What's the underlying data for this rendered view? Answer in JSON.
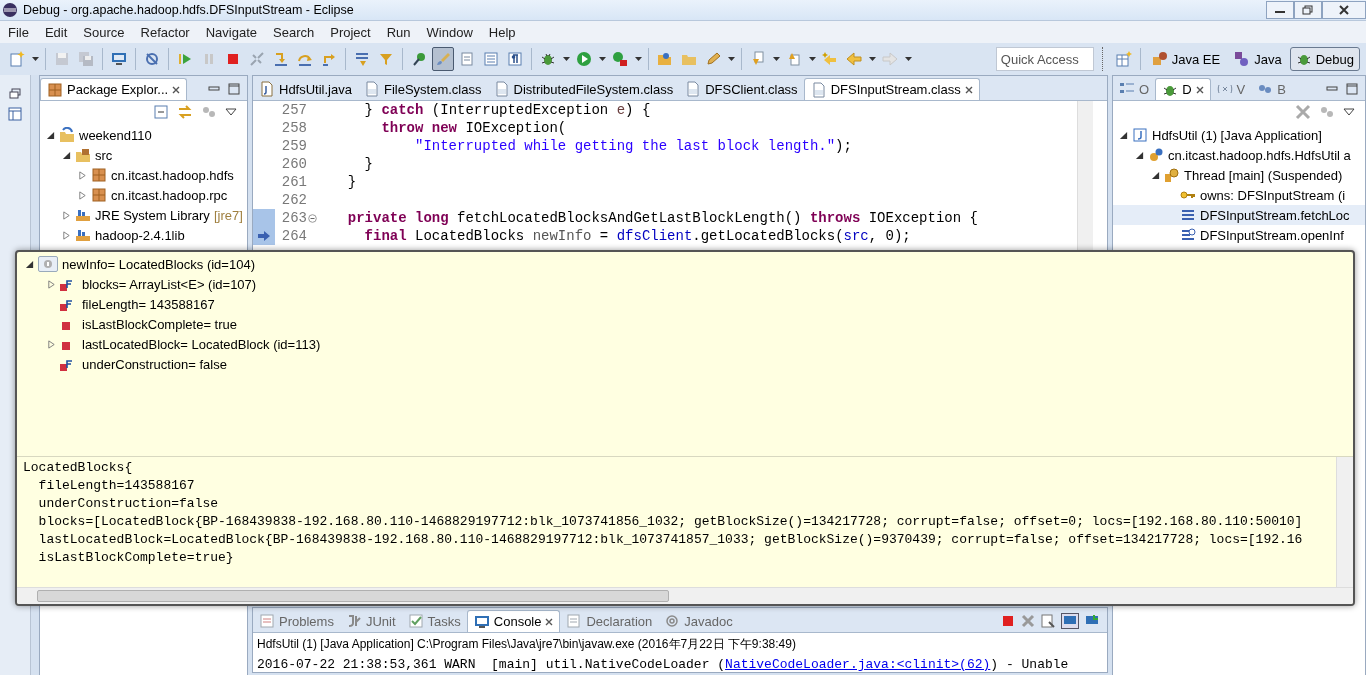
{
  "window": {
    "title": "Debug - org.apache.hadoop.hdfs.DFSInputStream - Eclipse"
  },
  "menu": [
    "File",
    "Edit",
    "Source",
    "Refactor",
    "Navigate",
    "Search",
    "Project",
    "Run",
    "Window",
    "Help"
  ],
  "toolbar": [
    [
      {
        "kind": "new",
        "selected": false
      },
      {
        "kind": "dropdown",
        "selected": false
      }
    ],
    [
      {
        "kind": "save",
        "selected": false
      },
      {
        "kind": "save-all",
        "selected": false
      }
    ],
    [
      {
        "kind": "monitor",
        "selected": false
      }
    ],
    [
      {
        "kind": "skip",
        "selected": false
      }
    ],
    [
      {
        "kind": "resume",
        "selected": false
      },
      {
        "kind": "suspend",
        "selected": false
      },
      {
        "kind": "terminate",
        "selected": false
      },
      {
        "kind": "disconnect",
        "selected": false
      },
      {
        "kind": "step-into",
        "selected": false
      },
      {
        "kind": "step-over",
        "selected": false
      },
      {
        "kind": "step-return",
        "selected": false
      }
    ],
    [
      {
        "kind": "drop-frame",
        "selected": false
      },
      {
        "kind": "step-filters",
        "selected": false
      }
    ],
    [
      {
        "kind": "breakpoint",
        "selected": false
      },
      {
        "kind": "brush",
        "selected": true
      },
      {
        "kind": "page",
        "selected": false
      },
      {
        "kind": "list",
        "selected": false
      },
      {
        "kind": "pilcrow",
        "selected": false
      }
    ],
    [
      {
        "kind": "bug",
        "selected": false
      },
      {
        "kind": "dropdown",
        "selected": false
      },
      {
        "kind": "run",
        "selected": false
      },
      {
        "kind": "dropdown",
        "selected": false
      },
      {
        "kind": "run-tool",
        "selected": false
      },
      {
        "kind": "dropdown",
        "selected": false
      }
    ],
    [
      {
        "kind": "open-folder",
        "selected": false
      },
      {
        "kind": "folder",
        "selected": false
      },
      {
        "kind": "pencil",
        "selected": false
      },
      {
        "kind": "dropdown",
        "selected": false
      }
    ],
    [
      {
        "kind": "next-annotation",
        "selected": false
      },
      {
        "kind": "dropdown",
        "selected": false
      },
      {
        "kind": "prev-annotation",
        "selected": false
      },
      {
        "kind": "dropdown",
        "selected": false
      },
      {
        "kind": "last-edit",
        "selected": false
      },
      {
        "kind": "back",
        "selected": false
      },
      {
        "kind": "dropdown",
        "selected": false
      },
      {
        "kind": "forward",
        "selected": false
      },
      {
        "kind": "dropdown",
        "selected": false
      }
    ]
  ],
  "quick_access": {
    "placeholder": "Quick Access"
  },
  "perspectives": [
    {
      "label": "Java EE",
      "kind": "javaee",
      "selected": false
    },
    {
      "label": "Java",
      "kind": "java",
      "selected": false
    },
    {
      "label": "Debug",
      "kind": "debug",
      "selected": true
    }
  ],
  "package_explorer": {
    "title": "Package Explor...",
    "tree": [
      {
        "label": "weekend110",
        "kind": "project",
        "expanded": true,
        "children": [
          {
            "label": "src",
            "kind": "source-folder",
            "expanded": true,
            "children": [
              {
                "label": "cn.itcast.hadoop.hdfs",
                "kind": "package",
                "expanded": false
              },
              {
                "label": "cn.itcast.hadoop.rpc",
                "kind": "package",
                "expanded": false
              }
            ]
          },
          {
            "label": "JRE System Library",
            "decoration": "[jre7]",
            "kind": "library",
            "expanded": false
          },
          {
            "label": "hadoop-2.4.1lib",
            "kind": "library",
            "expanded": false
          }
        ]
      }
    ]
  },
  "editor": {
    "tabs": [
      {
        "label": "HdfsUtil.java",
        "kind": "java",
        "selected": false
      },
      {
        "label": "FileSystem.class",
        "kind": "class",
        "selected": false
      },
      {
        "label": "DistributedFileSystem.class",
        "kind": "class",
        "selected": false
      },
      {
        "label": "DFSClient.class",
        "kind": "class",
        "selected": false
      },
      {
        "label": "DFSInputStream.class",
        "kind": "class",
        "selected": true
      }
    ],
    "lines": [
      {
        "number": "257",
        "segments": [
          {
            "kind": "plain",
            "text": "    }"
          },
          {
            "kind": "keyword",
            "text": " catch"
          },
          {
            "kind": "plain",
            "text": " (InterruptedException "
          },
          {
            "kind": "local",
            "text": "e"
          },
          {
            "kind": "plain",
            "text": ") {"
          }
        ]
      },
      {
        "number": "258",
        "segments": [
          {
            "kind": "keyword",
            "text": "      throw new"
          },
          {
            "kind": "plain",
            "text": " IOException("
          }
        ]
      },
      {
        "number": "259",
        "segments": [
          {
            "kind": "string",
            "text": "          \"Interrupted while getting the last block length.\""
          },
          {
            "kind": "plain",
            "text": ");"
          }
        ]
      },
      {
        "number": "260",
        "segments": [
          {
            "kind": "plain",
            "text": "    }"
          }
        ]
      },
      {
        "number": "261",
        "segments": [
          {
            "kind": "plain",
            "text": "  }"
          }
        ]
      },
      {
        "number": "262"
      },
      {
        "number": "263",
        "fold": true,
        "segments": [
          {
            "kind": "keyword",
            "text": "  private long"
          },
          {
            "kind": "plain",
            "text": " fetchLocatedBlocksAndGetLastBlockLength() "
          },
          {
            "kind": "keyword",
            "text": "throws"
          },
          {
            "kind": "plain",
            "text": " IOException {"
          }
        ]
      },
      {
        "number": "264",
        "current": true,
        "segments": [
          {
            "kind": "keyword",
            "text": "    final"
          },
          {
            "kind": "plain",
            "text": " LocatedBlocks "
          },
          {
            "kind": "hover",
            "text": "newInfo"
          },
          {
            "kind": "plain",
            "text": " = "
          },
          {
            "kind": "field",
            "text": "dfsClient"
          },
          {
            "kind": "plain",
            "text": ".getLocatedBlocks("
          },
          {
            "kind": "field",
            "text": "src"
          },
          {
            "kind": "plain",
            "text": ", 0);"
          }
        ]
      }
    ]
  },
  "debug_view": {
    "tabs": [
      {
        "label": "O",
        "kind": "outline",
        "selected": false
      },
      {
        "label": "D",
        "kind": "debug",
        "selected": true
      },
      {
        "label": "V",
        "kind": "variables",
        "selected": false
      },
      {
        "label": "B",
        "kind": "breakpoints",
        "selected": false
      }
    ],
    "tree": [
      {
        "label": "HdfsUtil (1) [Java Application]",
        "kind": "launch",
        "expanded": true,
        "selected": false,
        "children": [
          {
            "label": "cn.itcast.hadoop.hdfs.HdfsUtil a",
            "kind": "process",
            "expanded": true,
            "selected": false,
            "children": [
              {
                "label": "Thread [main] (Suspended)",
                "kind": "thread",
                "expanded": true,
                "selected": false,
                "children": [
                  {
                    "label": "owns: DFSInputStream  (i",
                    "kind": "monitor",
                    "selected": false
                  },
                  {
                    "label": "DFSInputStream.fetchLoc",
                    "kind": "frame",
                    "selected": true
                  },
                  {
                    "label": "DFSInputStream.openInf",
                    "kind": "frame-step",
                    "selected": false
                  }
                ]
              }
            ]
          }
        ]
      }
    ]
  },
  "hover_popup": {
    "variables": [
      {
        "text": "newInfo= LocatedBlocks  (id=104)",
        "kind": "local",
        "expanded": true,
        "children": [
          {
            "text": "blocks= ArrayList<E>  (id=107)",
            "kind": "object",
            "expanded": false,
            "final": true
          },
          {
            "text": "fileLength= 143588167",
            "kind": "value",
            "final": true
          },
          {
            "text": "isLastBlockComplete= true",
            "kind": "value",
            "final": false
          },
          {
            "text": "lastLocatedBlock= LocatedBlock  (id=113)",
            "kind": "object",
            "expanded": false,
            "final": false
          },
          {
            "text": "underConstruction= false",
            "kind": "value",
            "final": true
          }
        ]
      }
    ],
    "detail": [
      "LocatedBlocks{",
      "  fileLength=143588167",
      "  underConstruction=false",
      "  blocks=[LocatedBlock{BP-168439838-192.168.80.110-1468829197712:blk_1073741856_1032; getBlockSize()=134217728; corrupt=false; offset=0; locs=[192.168.80.110:50010]",
      "  lastLocatedBlock=LocatedBlock{BP-168439838-192.168.80.110-1468829197712:blk_1073741857_1033; getBlockSize()=9370439; corrupt=false; offset=134217728; locs=[192.16",
      "  isLastBlockComplete=true}"
    ]
  },
  "console": {
    "tabs": [
      {
        "label": "Problems",
        "kind": "problems",
        "selected": false
      },
      {
        "label": "JUnit",
        "kind": "junit",
        "selected": false
      },
      {
        "label": "Tasks",
        "kind": "tasks",
        "selected": false
      },
      {
        "label": "Console",
        "kind": "console",
        "selected": true
      },
      {
        "label": "Declaration",
        "kind": "declaration",
        "selected": false
      },
      {
        "label": "Javadoc",
        "kind": "javadoc",
        "selected": false
      }
    ],
    "header": "HdfsUtil (1) [Java Application] C:\\Program Files\\Java\\jre7\\bin\\javaw.exe (2016年7月22日 下午9:38:49)",
    "log": {
      "before": "2016-07-22 21:38:53,361 WARN  [main] util.NativeCodeLoader (",
      "link": "NativeCodeLoader.java:<clinit>(62)",
      "after": ") - Unable"
    }
  }
}
